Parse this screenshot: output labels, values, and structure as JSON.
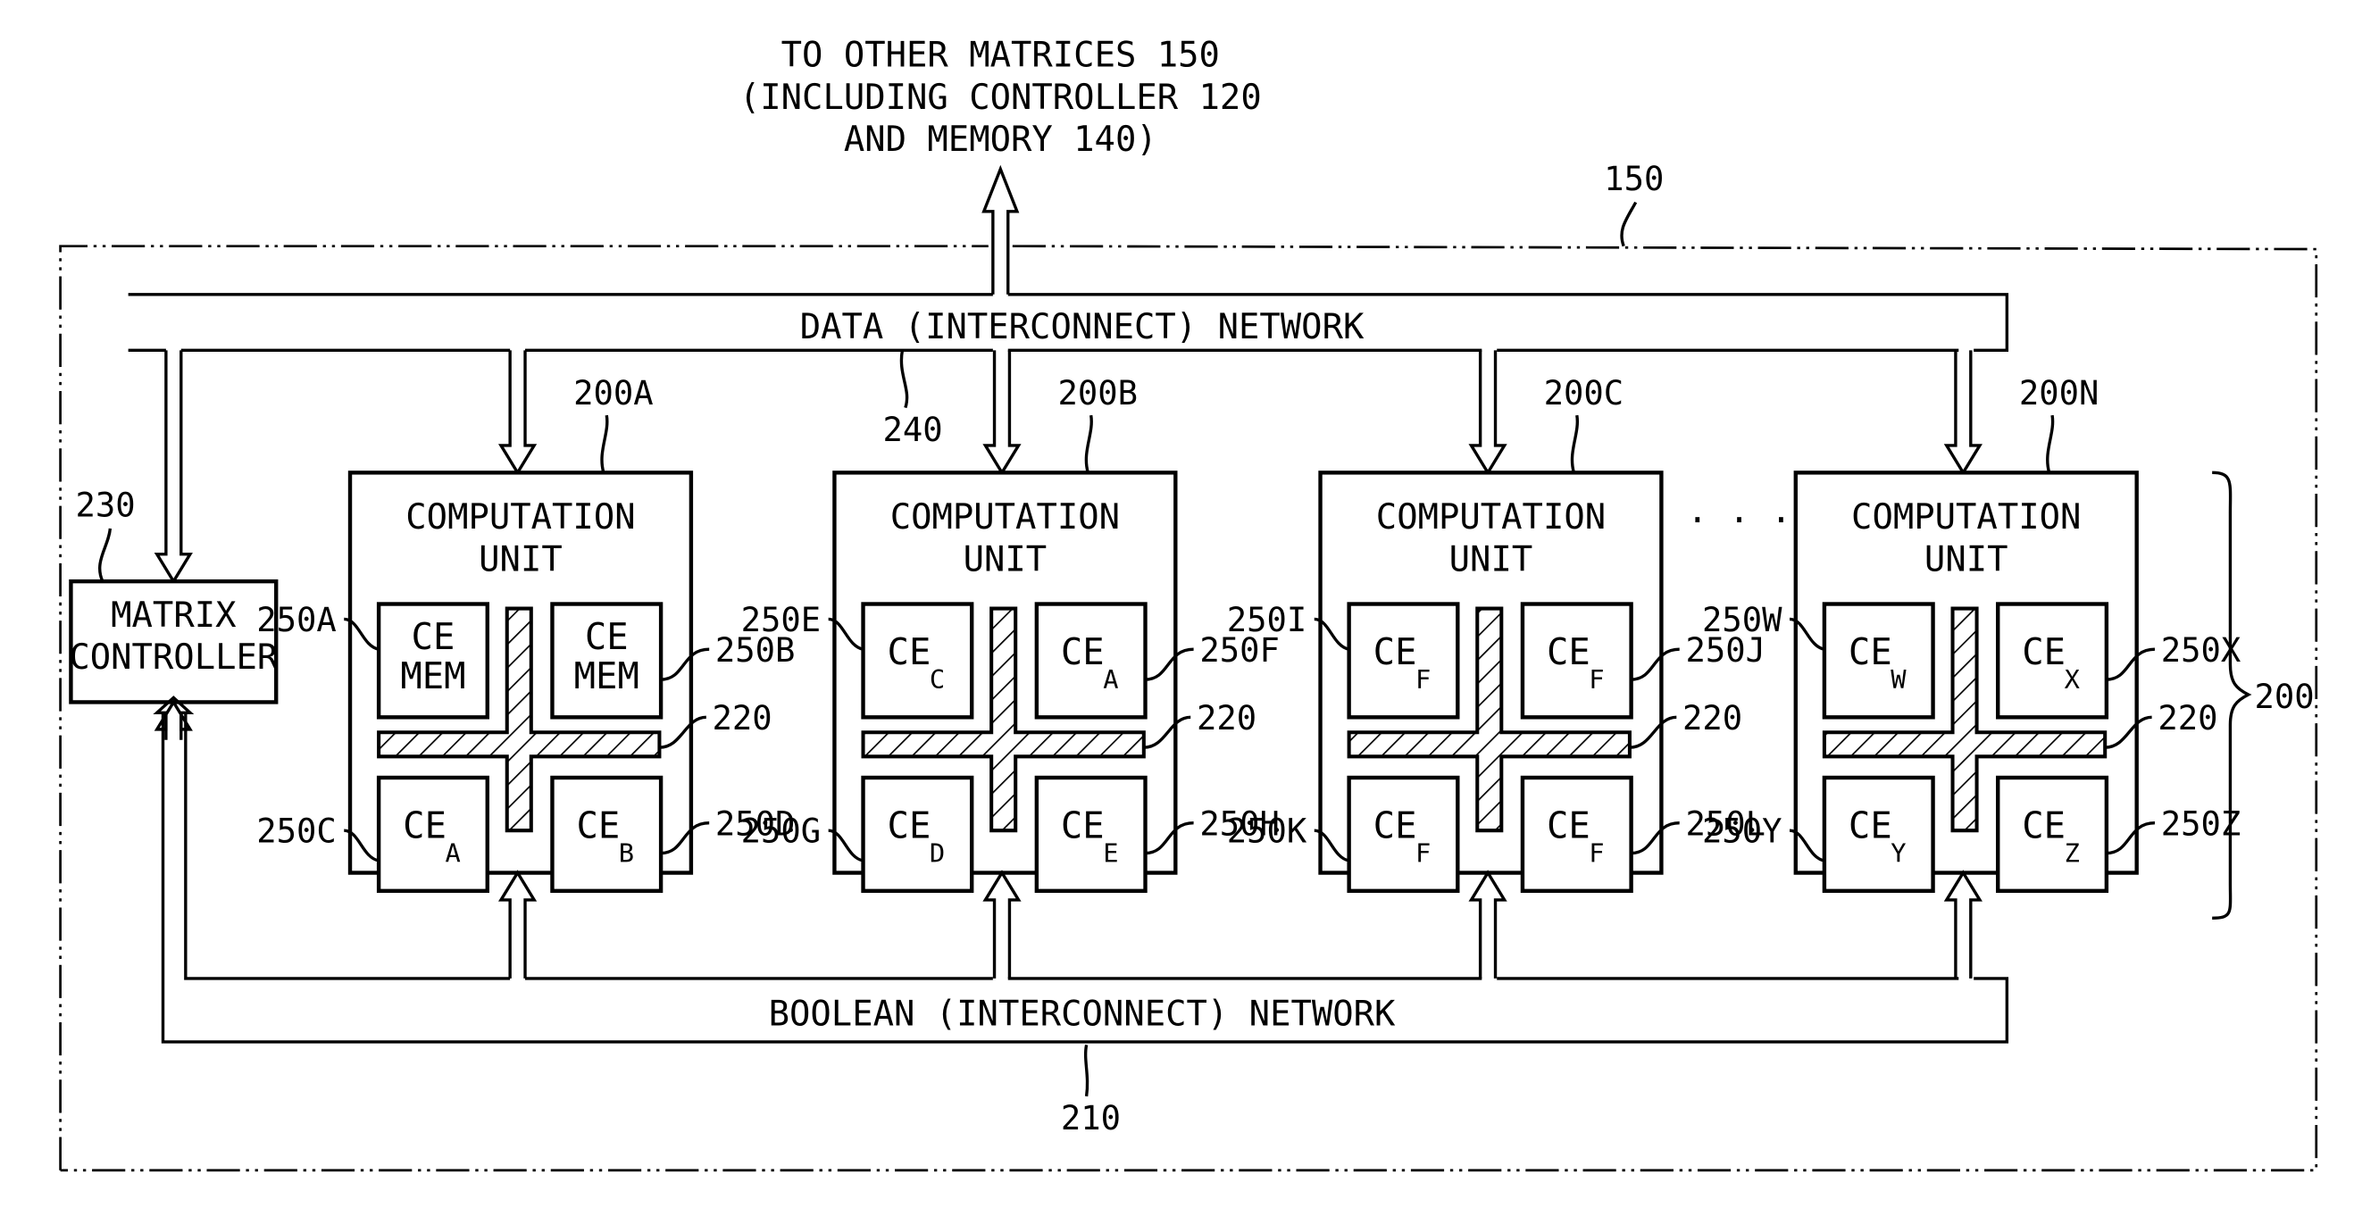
{
  "top_label": {
    "lines": [
      "TO OTHER MATRICES 150",
      "(INCLUDING CONTROLLER 120",
      "AND MEMORY 140)"
    ]
  },
  "ref_150": "150",
  "data_network": {
    "label": "DATA (INTERCONNECT) NETWORK",
    "ref": "240"
  },
  "boolean_network": {
    "label": "BOOLEAN (INTERCONNECT) NETWORK",
    "ref": "210"
  },
  "matrix_controller": {
    "lines": [
      "MATRIX",
      "CONTROLLER"
    ],
    "ref": "230"
  },
  "unit_group_ref": "200",
  "interconnect_ref": "220",
  "ellipsis": ". . .",
  "units": [
    {
      "ref": "200A",
      "title": [
        "COMPUTATION",
        "UNIT"
      ],
      "ces": [
        {
          "ref": "250A",
          "main": "CE",
          "sub": "",
          "line2": "MEM"
        },
        {
          "ref": "250B",
          "main": "CE",
          "sub": "",
          "line2": "MEM"
        },
        {
          "ref": "250C",
          "main": "CE",
          "sub": "A",
          "line2": ""
        },
        {
          "ref": "250D",
          "main": "CE",
          "sub": "B",
          "line2": ""
        }
      ]
    },
    {
      "ref": "200B",
      "title": [
        "COMPUTATION",
        "UNIT"
      ],
      "ces": [
        {
          "ref": "250E",
          "main": "CE",
          "sub": "C",
          "line2": ""
        },
        {
          "ref": "250F",
          "main": "CE",
          "sub": "A",
          "line2": ""
        },
        {
          "ref": "250G",
          "main": "CE",
          "sub": "D",
          "line2": ""
        },
        {
          "ref": "250H",
          "main": "CE",
          "sub": "E",
          "line2": ""
        }
      ]
    },
    {
      "ref": "200C",
      "title": [
        "COMPUTATION",
        "UNIT"
      ],
      "ces": [
        {
          "ref": "250I",
          "main": "CE",
          "sub": "F",
          "line2": ""
        },
        {
          "ref": "250J",
          "main": "CE",
          "sub": "F",
          "line2": ""
        },
        {
          "ref": "250K",
          "main": "CE",
          "sub": "F",
          "line2": ""
        },
        {
          "ref": "250L",
          "main": "CE",
          "sub": "F",
          "line2": ""
        }
      ]
    },
    {
      "ref": "200N",
      "title": [
        "COMPUTATION",
        "UNIT"
      ],
      "ces": [
        {
          "ref": "250W",
          "main": "CE",
          "sub": "W",
          "line2": ""
        },
        {
          "ref": "250X",
          "main": "CE",
          "sub": "X",
          "line2": ""
        },
        {
          "ref": "250Y",
          "main": "CE",
          "sub": "Y",
          "line2": ""
        },
        {
          "ref": "250Z",
          "main": "CE",
          "sub": "Z",
          "line2": ""
        }
      ]
    }
  ]
}
